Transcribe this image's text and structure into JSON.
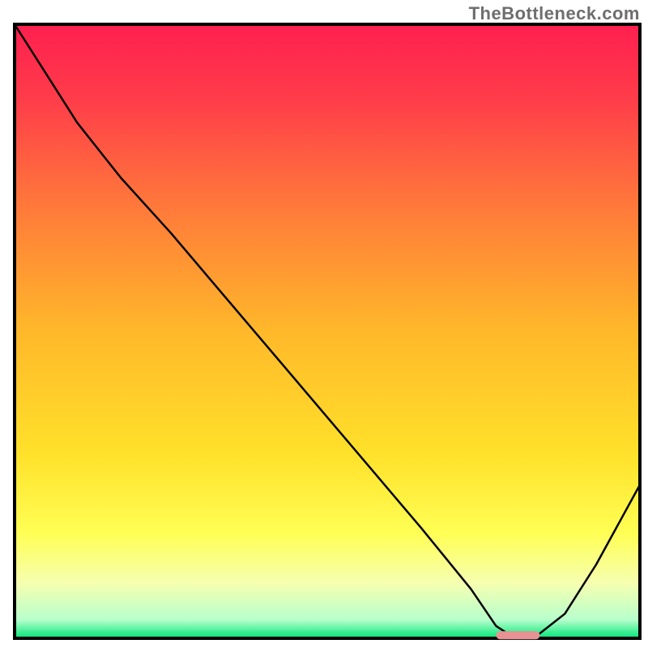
{
  "watermark": "TheBottleneck.com",
  "chart_data": {
    "type": "line",
    "title": "",
    "xlabel": "",
    "ylabel": "",
    "xlim": [
      0,
      100
    ],
    "ylim": [
      0,
      100
    ],
    "x": [
      0,
      5,
      10,
      17,
      25,
      35,
      45,
      55,
      65,
      73,
      77,
      80,
      83,
      88,
      93,
      100
    ],
    "values": [
      100,
      92,
      84,
      75,
      66,
      54,
      42,
      30,
      18,
      8,
      2,
      0,
      0,
      4,
      12,
      25
    ],
    "flat_segment": {
      "start_x": 77,
      "end_x": 84,
      "y": 0
    },
    "marker": {
      "type": "rounded-bar",
      "x_start": 77,
      "x_end": 84,
      "y": 0.5,
      "color": "#e79393"
    },
    "gradient_stops": [
      {
        "offset": 0.0,
        "color": "#ff1f4f"
      },
      {
        "offset": 0.12,
        "color": "#ff3c4a"
      },
      {
        "offset": 0.3,
        "color": "#ff7a3a"
      },
      {
        "offset": 0.5,
        "color": "#ffb82a"
      },
      {
        "offset": 0.7,
        "color": "#ffe12a"
      },
      {
        "offset": 0.83,
        "color": "#ffff55"
      },
      {
        "offset": 0.91,
        "color": "#f6ffb0"
      },
      {
        "offset": 0.97,
        "color": "#b7ffcc"
      },
      {
        "offset": 1.0,
        "color": "#00e676"
      }
    ],
    "border_color": "#000000"
  }
}
